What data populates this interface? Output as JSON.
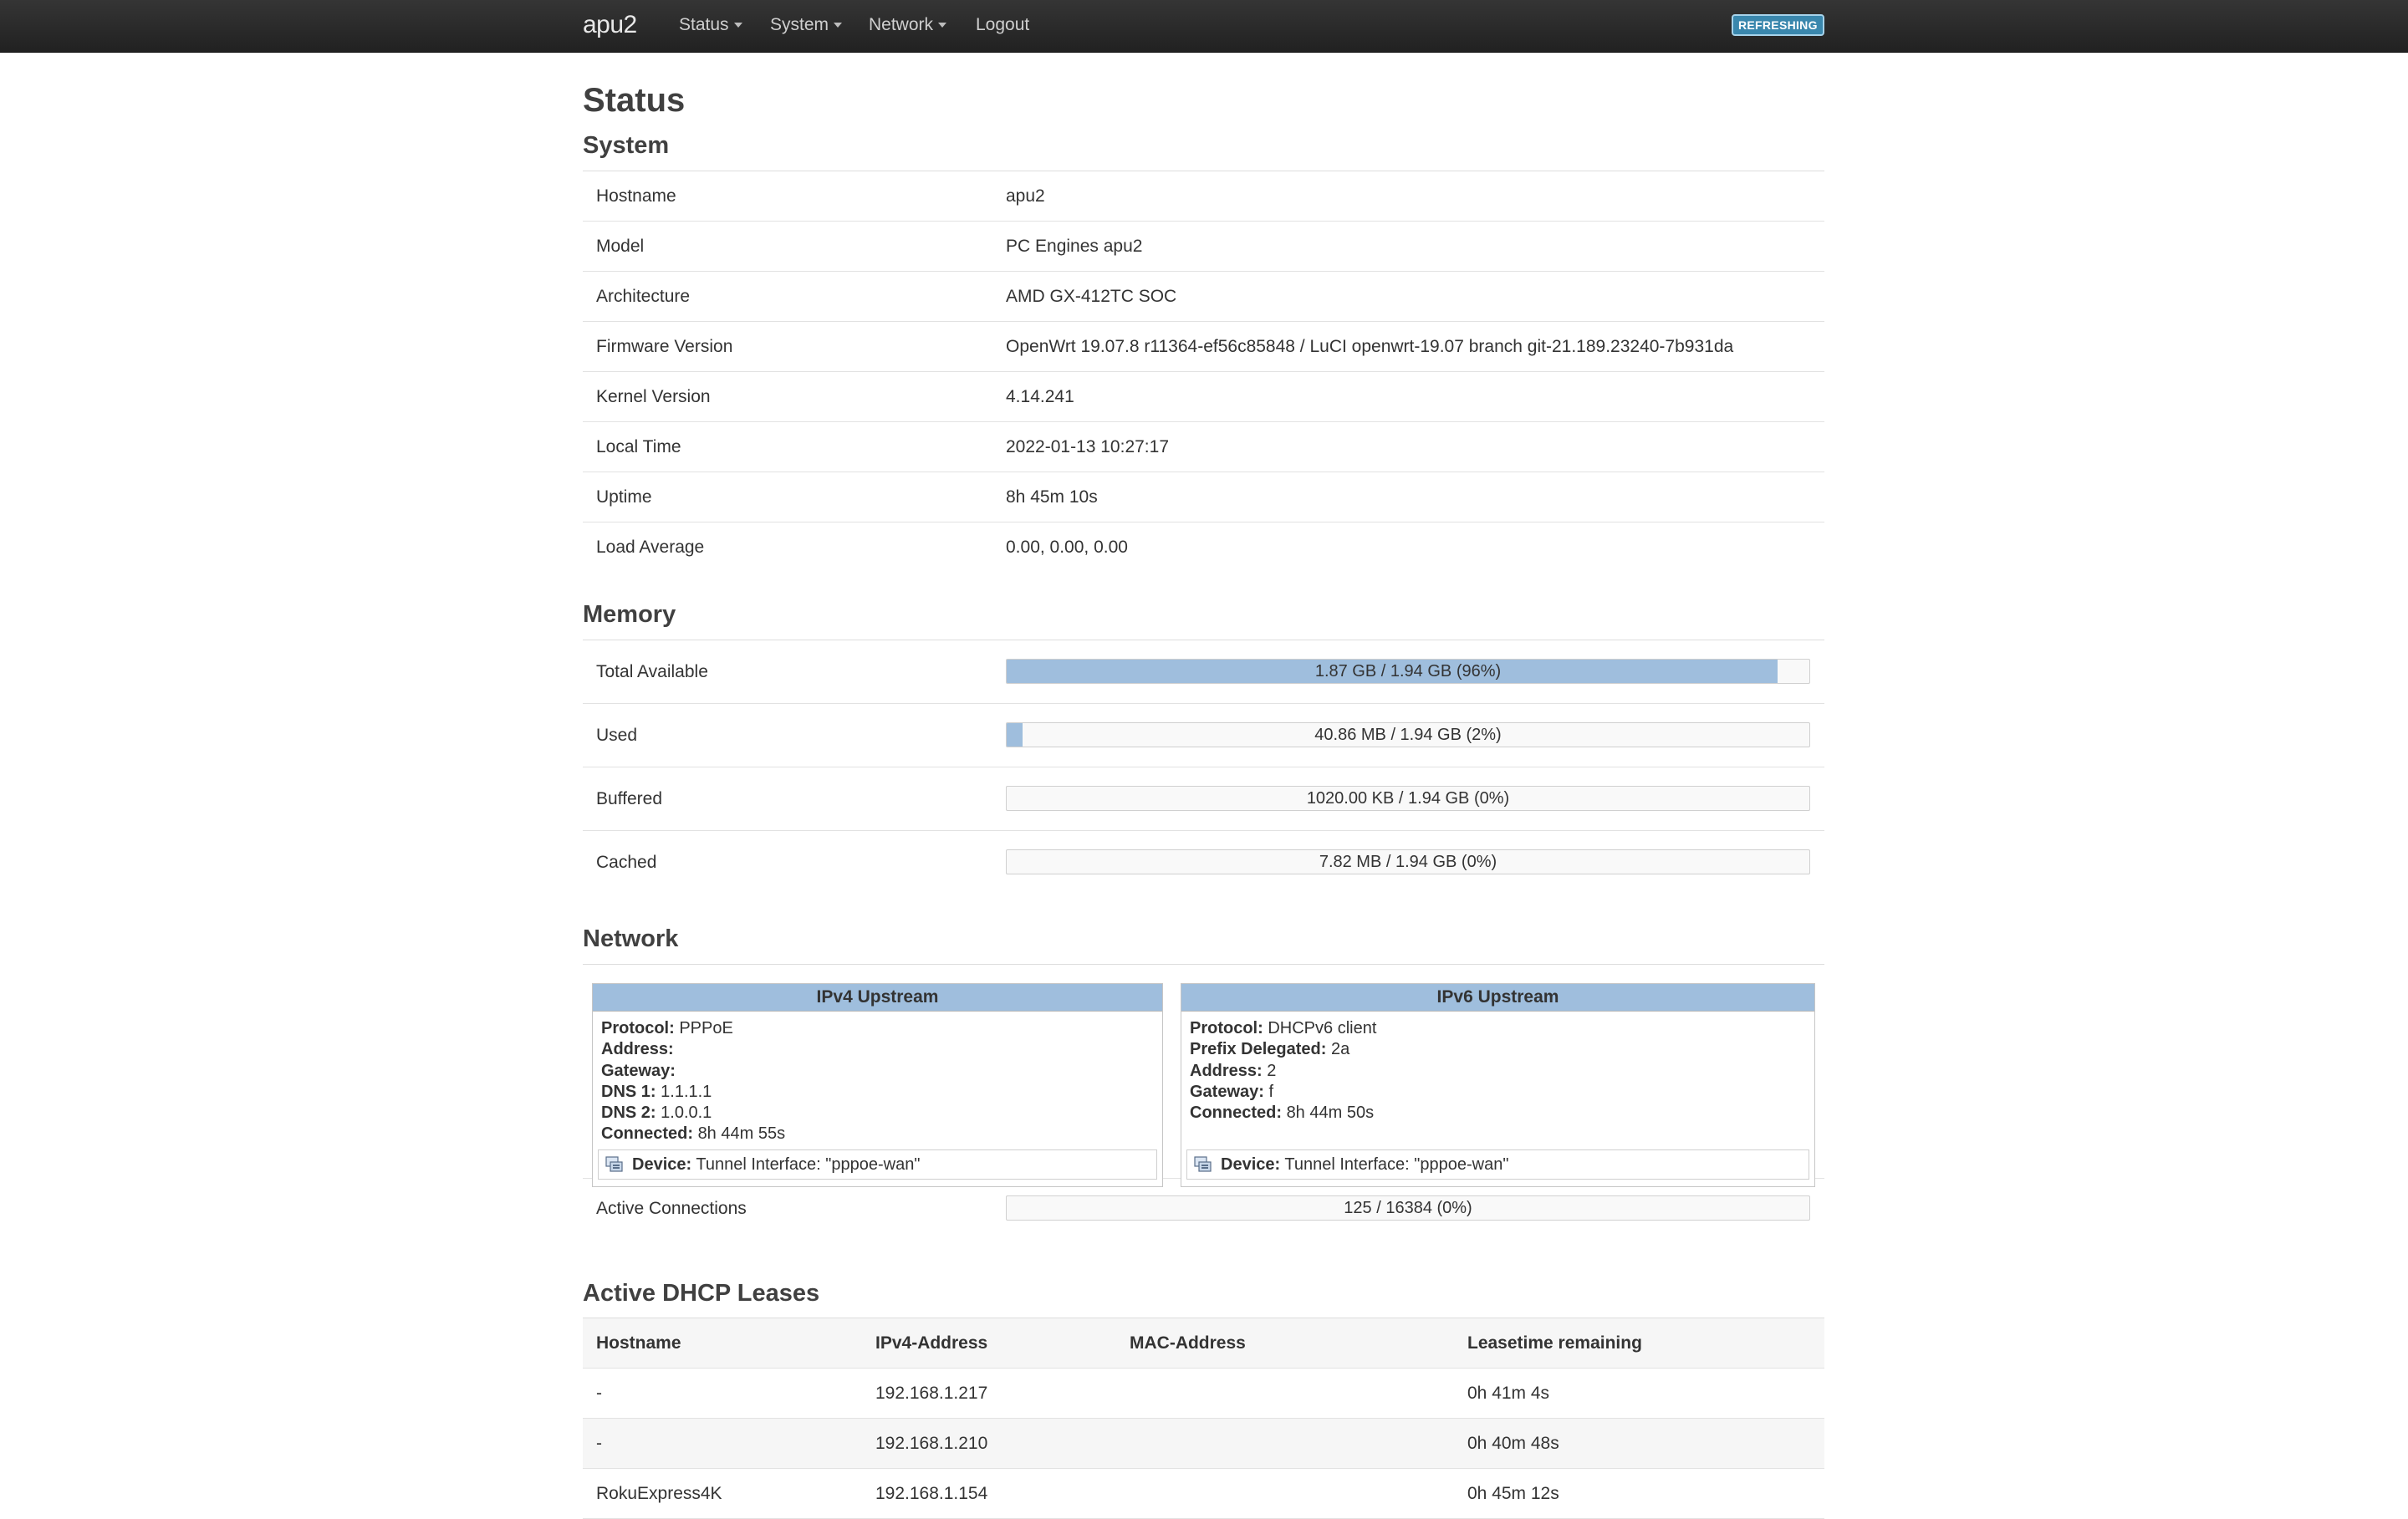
{
  "nav": {
    "brand": "apu2",
    "items": [
      {
        "label": "Status",
        "has_caret": true
      },
      {
        "label": "System",
        "has_caret": true
      },
      {
        "label": "Network",
        "has_caret": true
      },
      {
        "label": "Logout",
        "has_caret": false
      }
    ],
    "badge": "REFRESHING"
  },
  "page_title": "Status",
  "system": {
    "heading": "System",
    "rows": [
      {
        "key": "Hostname",
        "value": "apu2"
      },
      {
        "key": "Model",
        "value": "PC Engines apu2"
      },
      {
        "key": "Architecture",
        "value": "AMD GX-412TC SOC"
      },
      {
        "key": "Firmware Version",
        "value": "OpenWrt 19.07.8 r11364-ef56c85848 / LuCI openwrt-19.07 branch git-21.189.23240-7b931da"
      },
      {
        "key": "Kernel Version",
        "value": "4.14.241"
      },
      {
        "key": "Local Time",
        "value": "2022-01-13 10:27:17"
      },
      {
        "key": "Uptime",
        "value": "8h 45m 10s"
      },
      {
        "key": "Load Average",
        "value": "0.00, 0.00, 0.00"
      }
    ]
  },
  "memory": {
    "heading": "Memory",
    "rows": [
      {
        "key": "Total Available",
        "label": "1.87 GB / 1.94 GB (96%)",
        "fraction": 0.96
      },
      {
        "key": "Used",
        "label": "40.86 MB / 1.94 GB (2%)",
        "fraction": 0.02
      },
      {
        "key": "Buffered",
        "label": "1020.00 KB / 1.94 GB (0%)",
        "fraction": 0.0
      },
      {
        "key": "Cached",
        "label": "7.82 MB / 1.94 GB (0%)",
        "fraction": 0.0
      }
    ]
  },
  "network": {
    "heading": "Network",
    "ipv4": {
      "title": "IPv4 Upstream",
      "protocol_label": "Protocol:",
      "protocol": "PPPoE",
      "address_label": "Address:",
      "address": "",
      "gateway_label": "Gateway:",
      "gateway": "",
      "dns1_label": "DNS 1:",
      "dns1": "1.1.1.1",
      "dns2_label": "DNS 2:",
      "dns2": "1.0.0.1",
      "connected_label": "Connected:",
      "connected": "8h 44m 55s",
      "device_label": "Device:",
      "device": "Tunnel Interface: \"pppoe-wan\""
    },
    "ipv6": {
      "title": "IPv6 Upstream",
      "protocol_label": "Protocol:",
      "protocol": "DHCPv6 client",
      "prefix_label": "Prefix Delegated:",
      "prefix": "2a",
      "address_label": "Address:",
      "address": "2",
      "gateway_label": "Gateway:",
      "gateway": "f",
      "connected_label": "Connected:",
      "connected": "8h 44m 50s",
      "device_label": "Device:",
      "device": "Tunnel Interface: \"pppoe-wan\""
    },
    "active_connections": {
      "key": "Active Connections",
      "label": "125 / 16384 (0%)",
      "fraction": 0.0
    }
  },
  "dhcp": {
    "heading": "Active DHCP Leases",
    "columns": [
      "Hostname",
      "IPv4-Address",
      "MAC-Address",
      "Leasetime remaining"
    ],
    "rows": [
      {
        "hostname": "-",
        "ipv4": "192.168.1.217",
        "mac": "",
        "lease": "0h 41m 4s"
      },
      {
        "hostname": "-",
        "ipv4": "192.168.1.210",
        "mac": "",
        "lease": "0h 40m 48s"
      },
      {
        "hostname": "RokuExpress4K",
        "ipv4": "192.168.1.154",
        "mac": "",
        "lease": "0h 45m 12s"
      }
    ]
  },
  "colors": {
    "bar_fill": "#9fbedd",
    "navbar": "#262626",
    "badge": "#3a87ad"
  }
}
